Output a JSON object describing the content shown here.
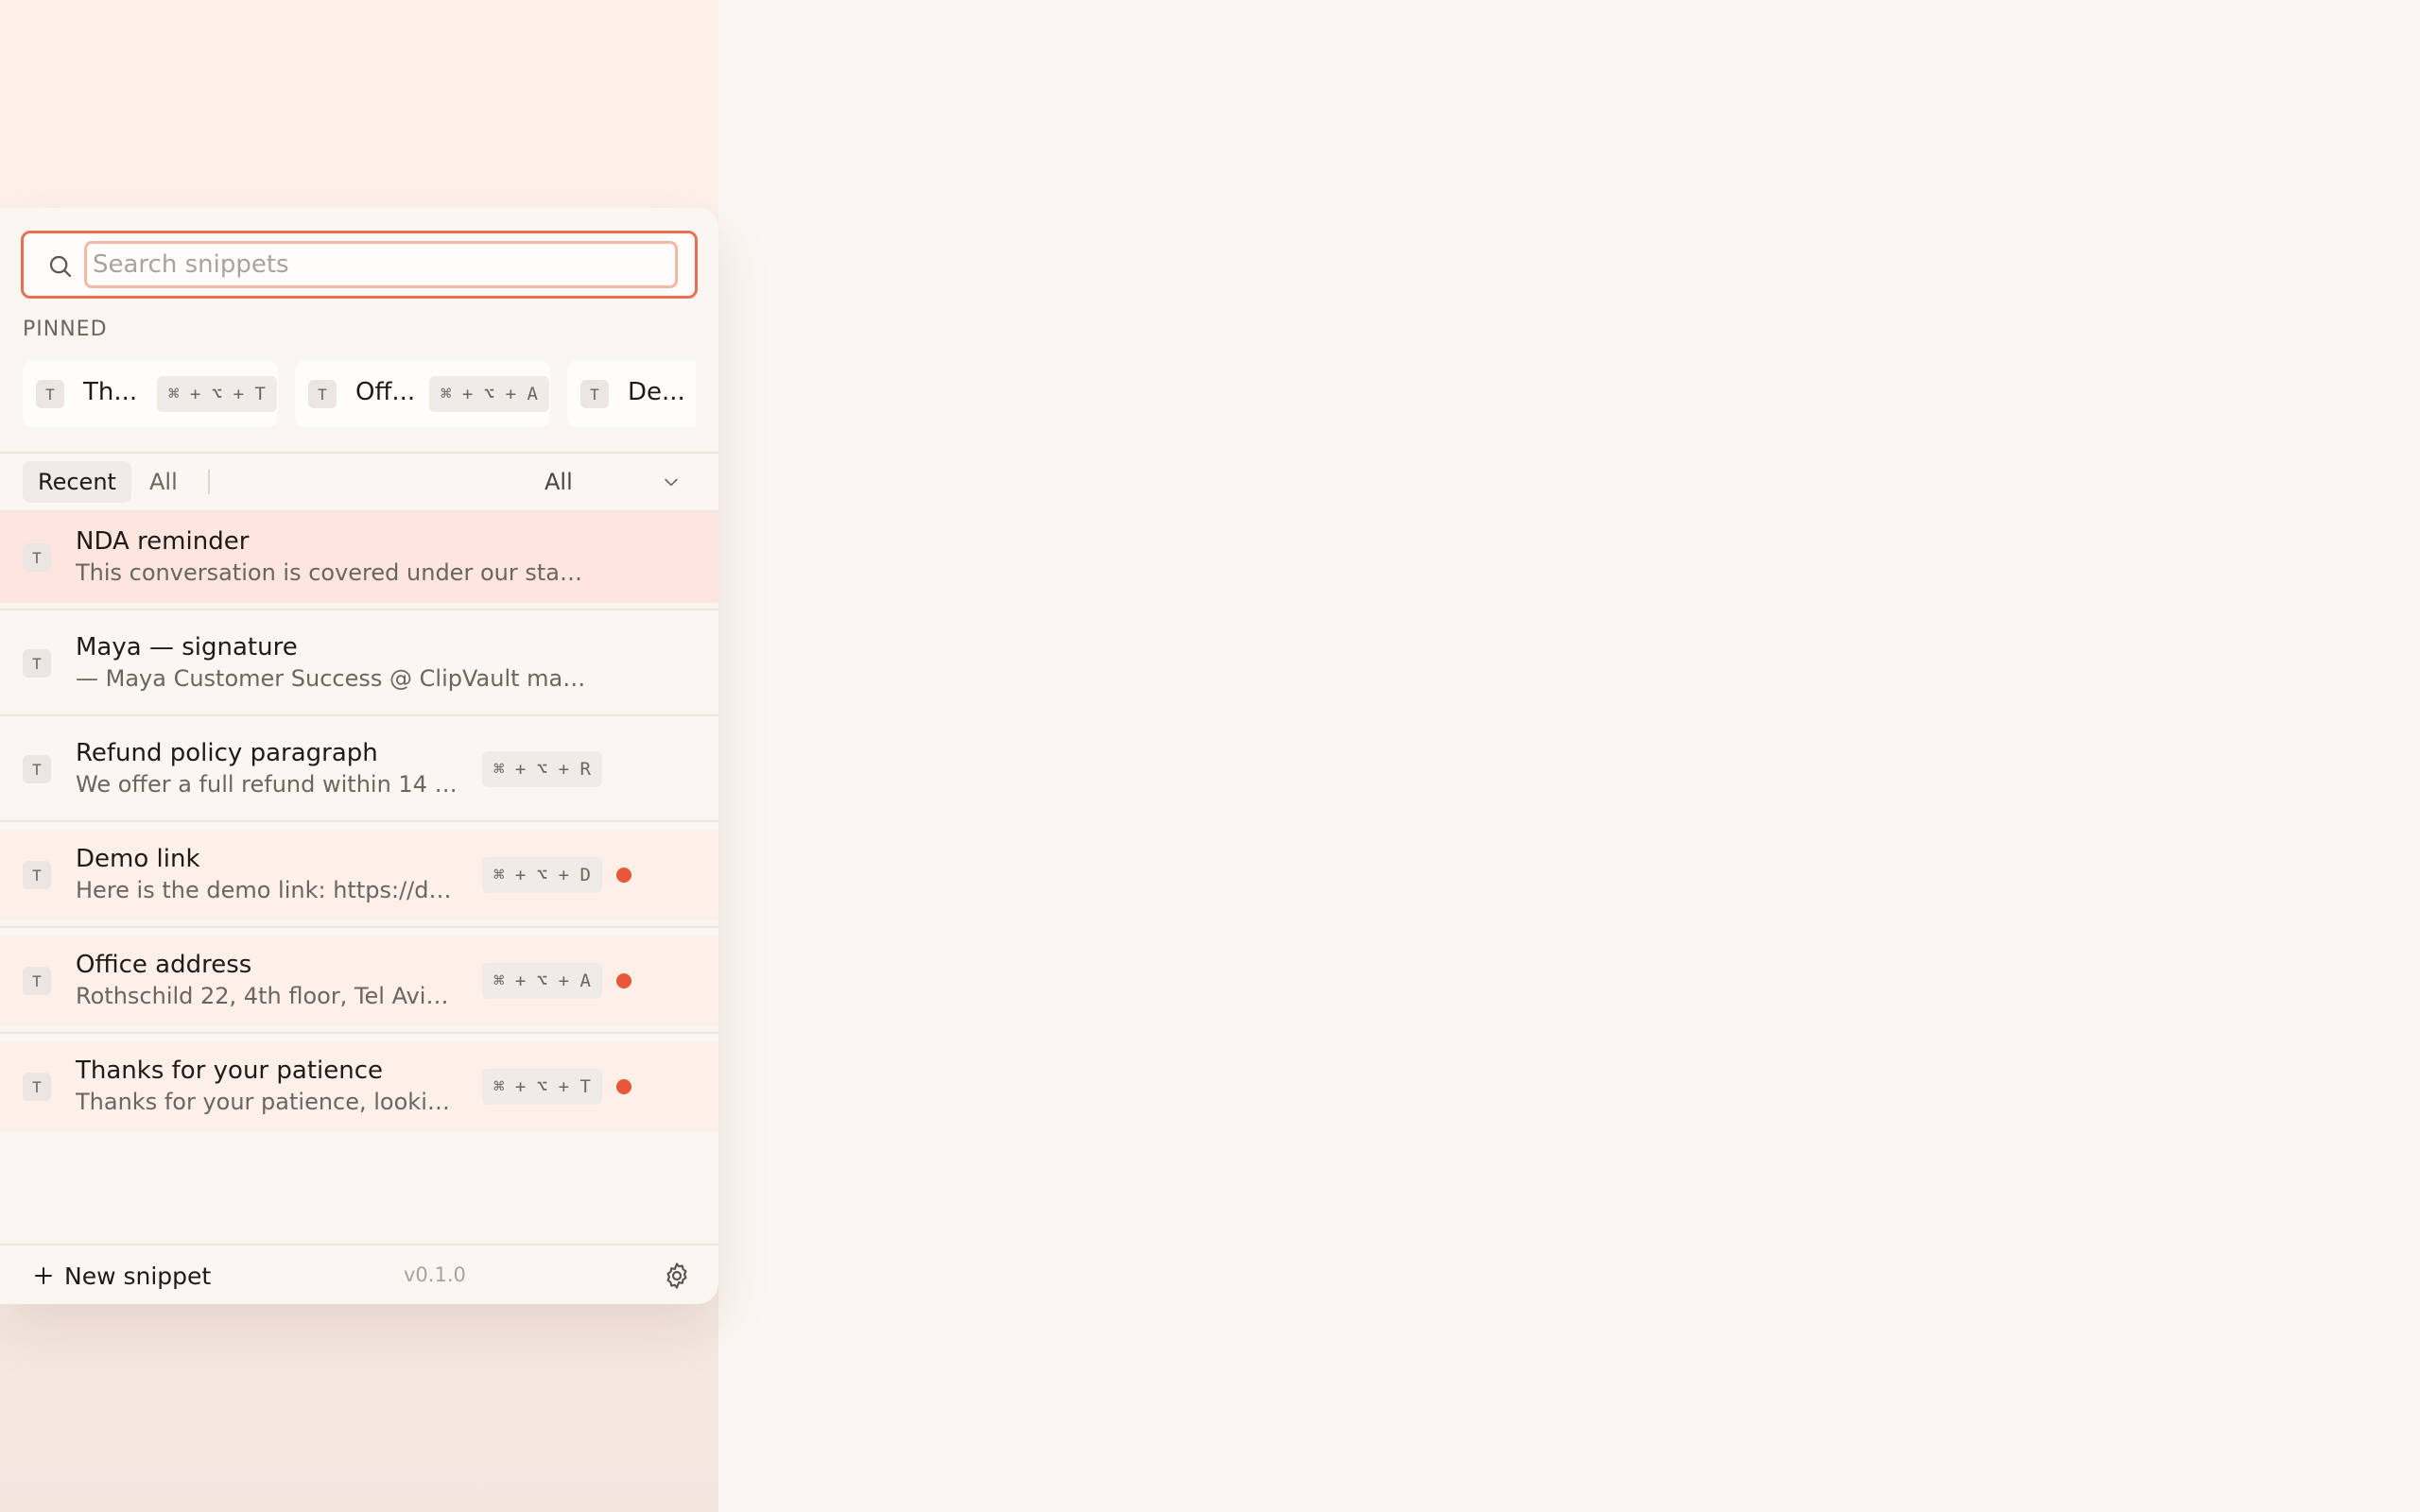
{
  "search": {
    "placeholder": "Search snippets",
    "value": ""
  },
  "pinned": {
    "label": "PINNED",
    "items": [
      {
        "badge": "T",
        "title": "Th...",
        "shortcut": "⌘ + ⌥ + T"
      },
      {
        "badge": "T",
        "title": "Off...",
        "shortcut": "⌘ + ⌥ + A"
      },
      {
        "badge": "T",
        "title": "De...",
        "shortcut": ""
      }
    ]
  },
  "tabs": {
    "recent": "Recent",
    "all": "All"
  },
  "filter": {
    "selected": "All"
  },
  "snippets": [
    {
      "badge": "T",
      "title": "NDA reminder",
      "preview": "This conversation is covered under our stand...",
      "shortcut": "",
      "pinned": false,
      "selected": true
    },
    {
      "badge": "T",
      "title": "Maya — signature",
      "preview": "— Maya Customer Success @ ClipVault maya...",
      "shortcut": "",
      "pinned": false,
      "selected": false
    },
    {
      "badge": "T",
      "title": "Refund policy paragraph",
      "preview": "We offer a full refund within 14 d...",
      "shortcut": "⌘ + ⌥ + R",
      "pinned": false,
      "selected": false
    },
    {
      "badge": "T",
      "title": "Demo link",
      "preview": "Here is the demo link: https://de...",
      "shortcut": "⌘ + ⌥ + D",
      "pinned": true,
      "selected": false
    },
    {
      "badge": "T",
      "title": "Office address",
      "preview": "Rothschild 22, 4th floor, Tel Aviv. ...",
      "shortcut": "⌘ + ⌥ + A",
      "pinned": true,
      "selected": false
    },
    {
      "badge": "T",
      "title": "Thanks for your patience",
      "preview": "Thanks for your patience, lookin...",
      "shortcut": "⌘ + ⌥ + T",
      "pinned": true,
      "selected": false
    }
  ],
  "footer": {
    "new_label": "New snippet",
    "version": "v0.1.0"
  },
  "colors": {
    "accent": "#e96f54",
    "pin_dot": "#e8573a",
    "selected_row": "#fde6de",
    "pinned_row": "#fdf0e8"
  }
}
